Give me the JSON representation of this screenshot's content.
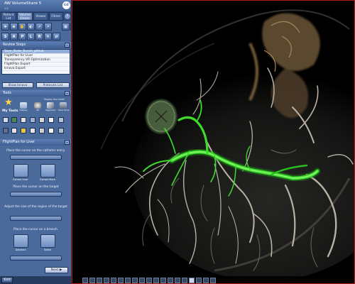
{
  "app": {
    "title": "AW VolumeShare 5",
    "version": "4.6",
    "logo": "GE"
  },
  "tabs": [
    {
      "label": "Patient\nList",
      "active": false
    },
    {
      "label": "Volume\nViewer",
      "active": true
    },
    {
      "label": "Viewer",
      "active": false
    },
    {
      "label": "Filmer",
      "active": false
    }
  ],
  "toolbar": {
    "row2_letters": [
      "S",
      "A",
      "P",
      "L",
      "R"
    ]
  },
  "review_steps": {
    "header": "Review Steps",
    "items": [
      "Save_State_Bunch_github",
      "FlightPlan for Liver",
      "Transparency VR Optimization",
      "FlightPlan Export",
      "Innova Export"
    ],
    "selected_index": 0,
    "show_innova_label": "Show Innova",
    "protocols_list_label": "Protocols List"
  },
  "tools": {
    "header": "Tools",
    "subheader": "Display tool mode",
    "my_tools_label": "My Tools",
    "tool_labels": [
      "Display",
      "3D",
      "Segment",
      "Slice Tools"
    ]
  },
  "flightplan": {
    "header": "FlightPlan for Liver",
    "step1": "Place the cursor on the catheter entry.",
    "step2": "Place the cursor on the target",
    "step3": "Adjust the size of the region of the target",
    "step4": "Place the cursor on a branch.",
    "extract_liver_label": "Extract Liver",
    "extract_more_label": "Extract More",
    "deselect_label": "Deselect",
    "select_label": "Select",
    "next_label": "Next"
  },
  "bottom": {
    "exit_label": "Exit"
  },
  "colors": {
    "panel_bg": "#4a6a9c",
    "vessel_green": "#3ddc2a",
    "viewer_border": "#b71818"
  }
}
